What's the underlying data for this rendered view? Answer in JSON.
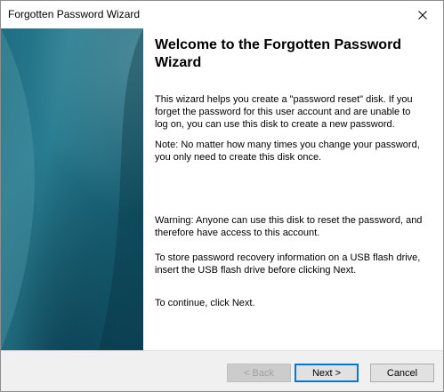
{
  "window": {
    "title": "Forgotten Password Wizard",
    "close_icon": "close-icon"
  },
  "content": {
    "heading": "Welcome to the Forgotten Password Wizard",
    "paragraphs": [
      "This wizard helps you create a \"password reset\" disk. If you forget the password for this user account and are unable to log on, you can use this disk to create a new password.",
      "Note: No matter how many times you change your password, you only need to create this disk once.",
      "Warning: Anyone can use this disk to reset the password, and therefore have access to this account.",
      "To store password recovery information on a USB flash drive, insert the USB flash drive before clicking Next.",
      "To continue, click Next."
    ]
  },
  "buttons": {
    "back": "< Back",
    "next": "Next >",
    "cancel": "Cancel"
  },
  "colors": {
    "sidebar": "#1f6d82",
    "focus_border": "#0078d7",
    "footer_bg": "#f0f0f0"
  }
}
